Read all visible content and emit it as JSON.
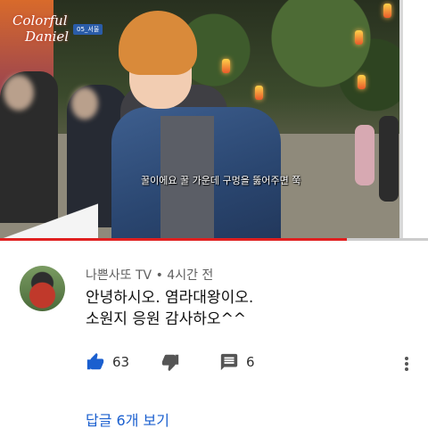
{
  "video": {
    "channel_logo_text_line1": "Colorful",
    "channel_logo_text_line2": "Daniel",
    "episode_badge": "05_서울",
    "subtitle": "꿀이에요 꿀 가운데 구멍을 뚫어주면 쭉",
    "progress_fraction": 0.81,
    "progress_color": "#e02020"
  },
  "comment": {
    "author": "나쁜사또 TV",
    "separator": "•",
    "time": "4시간 전",
    "text_line1": "안녕하시오. 염라대왕이오.",
    "text_line2": "소원지 응원 감사하오^^",
    "likes": "63",
    "replies_count": "6",
    "view_replies_label": "답글 6개 보기",
    "accent_color": "#1a5fcf",
    "icons": {
      "like": "thumbs-up-icon",
      "dislike": "thumbs-down-icon",
      "reply": "comment-icon",
      "menu": "more-vertical-icon"
    }
  }
}
